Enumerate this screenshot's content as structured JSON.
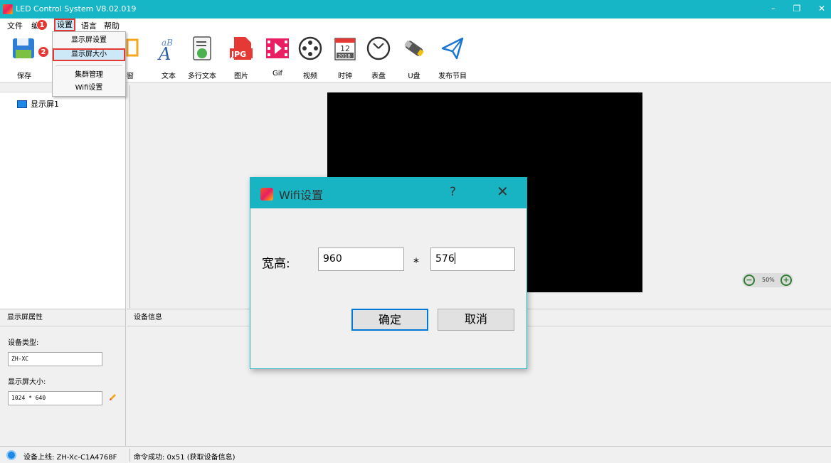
{
  "window": {
    "title": "LED Control System V8.02.019",
    "min": "–",
    "restore": "❐",
    "close": "✕"
  },
  "menu": {
    "file": "文件",
    "edit": "编",
    "settings": "设置",
    "language": "语言",
    "help": "帮助"
  },
  "badges": {
    "one": "1",
    "two": "2"
  },
  "dropdown": {
    "items": [
      "显示屏设置",
      "显示屏大小",
      "集群管理",
      "Wifi设置"
    ]
  },
  "toolbar": {
    "save": "保存",
    "window_partial": "件窗",
    "text": "文本",
    "multiline": "多行文本",
    "picture": "图片",
    "gif": "Gif",
    "video": "视频",
    "clock": "时钟",
    "dial": "表盘",
    "udisk": "U盘",
    "publish": "发布节目",
    "aB": "aB",
    "a_letter": "A",
    "jpg": "JPG",
    "cal_day": "12",
    "cal_year": "2018"
  },
  "tree": {
    "item": "显示屏1"
  },
  "zoom": {
    "value": "50%",
    "minus": "−",
    "plus": "+"
  },
  "props": {
    "header": "显示屏属性",
    "device_type_label": "设备类型:",
    "device_type_value": "ZH-XC",
    "size_label": "显示屏大小:",
    "size_value": "1024 * 640"
  },
  "device_info": {
    "header": "设备信息"
  },
  "status": {
    "online": "设备上线: ZH-Xc-C1A4768F",
    "result": "命令成功: 0x51 (获取设备信息)"
  },
  "dialog": {
    "title": "Wifi设置",
    "help": "?",
    "close": "✕",
    "label": "宽高:",
    "width": "960",
    "height": "576",
    "separator": "*",
    "ok": "确定",
    "cancel": "取消"
  },
  "colors": {
    "accent": "#16b6c6",
    "highlight": "#e53935",
    "screen": "#000000"
  }
}
